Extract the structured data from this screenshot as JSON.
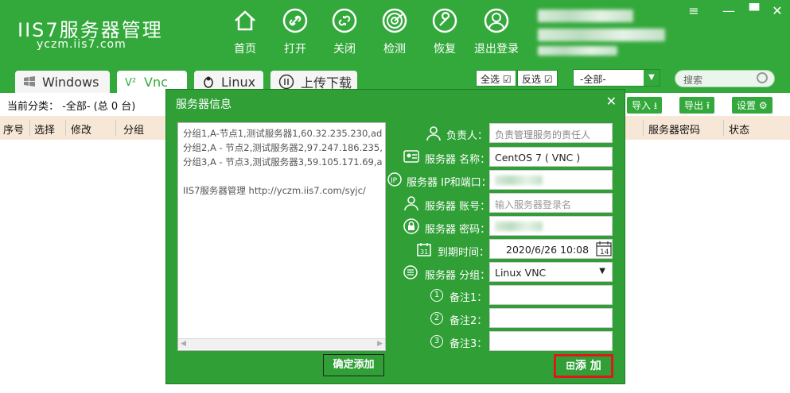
{
  "app": {
    "logo_text": "IIS7服务器管理",
    "logo_url": "yczm.iis7.com"
  },
  "nav": [
    {
      "label": "首页",
      "icon": "home-icon"
    },
    {
      "label": "打开",
      "icon": "link-icon"
    },
    {
      "label": "关闭",
      "icon": "unlink-icon"
    },
    {
      "label": "检测",
      "icon": "radar-icon"
    },
    {
      "label": "恢复",
      "icon": "wrench-icon"
    },
    {
      "label": "退出登录",
      "icon": "user-icon"
    }
  ],
  "window_controls": [
    "≡",
    "—",
    "✕"
  ],
  "tabs": [
    {
      "label": "Windows",
      "icon": "windows-icon",
      "active": false
    },
    {
      "label": "Vnc",
      "icon": "vnc-icon",
      "active": true
    },
    {
      "label": "Linux",
      "icon": "linux-icon",
      "active": false
    },
    {
      "label": "上传下载",
      "icon": "upload-download-icon",
      "active": false
    }
  ],
  "selection": {
    "select_all": "全选",
    "invert": "反选"
  },
  "filter": {
    "value": "-全部-"
  },
  "search": {
    "placeholder": "搜索"
  },
  "category": {
    "text": "当前分类： -全部- (总 0 台)"
  },
  "toolbar": {
    "import": "导入",
    "export": "导出",
    "settings": "设置"
  },
  "table": {
    "headers": [
      "序号",
      "选择",
      "修改",
      "分组",
      "服务器密码",
      "状态"
    ]
  },
  "modal": {
    "title": "服务器信息",
    "close": "✕",
    "textarea_lines": [
      "分组1,A-节点1,测试服务器1,60.32.235.230,ad",
      "分组2,A - 节点2,测试服务器2,97.247.186.235,",
      "分组3,A - 节点3,测试服务器3,59.105.171.69,a",
      "",
      "IIS7服务器管理 http://yczm.iis7.com/syjc/"
    ],
    "confirm_label": "确定添加",
    "add_label": "添 加",
    "fields": {
      "owner_label": "负责人：",
      "owner_value": "负责管理服务的责任人",
      "name_label": "服务器 名称：",
      "name_value": "CentOS 7 ( VNC )",
      "ip_label": "服务器 IP和端口：",
      "account_label": "服务器 账号：",
      "account_placeholder": "输入服务器登录名",
      "password_label": "服务器 密码：",
      "expire_label": "到期时间：",
      "expire_value": "2020/6/26 10:08",
      "group_label": "服务器 分组：",
      "group_value": "Linux VNC",
      "note1_label": "备注1：",
      "note2_label": "备注2：",
      "note3_label": "备注3："
    }
  },
  "colors": {
    "primary_green": "#33a93b",
    "modal_green": "#2f9f36",
    "header_row": "#f7e7d6",
    "highlight_red": "#e0181e"
  }
}
